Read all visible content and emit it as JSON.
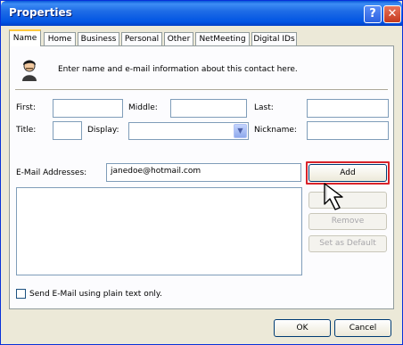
{
  "window": {
    "title": "Properties",
    "help_glyph": "?",
    "close_glyph": "✕"
  },
  "tabs": [
    {
      "label": "Name",
      "active": true
    },
    {
      "label": "Home"
    },
    {
      "label": "Business"
    },
    {
      "label": "Personal"
    },
    {
      "label": "Other"
    },
    {
      "label": "NetMeeting"
    },
    {
      "label": "Digital IDs"
    }
  ],
  "intro_text": "Enter name and e-mail information about this contact here.",
  "name_fields": {
    "first_label": "First:",
    "first_value": "",
    "middle_label": "Middle:",
    "middle_value": "",
    "last_label": "Last:",
    "last_value": "",
    "title_label": "Title:",
    "title_value": "",
    "display_label": "Display:",
    "display_value": "",
    "nickname_label": "Nickname:",
    "nickname_value": ""
  },
  "email": {
    "label": "E-Mail Addresses:",
    "input_value": "janedoe@hotmail.com",
    "list_items": []
  },
  "buttons": {
    "add": "Add",
    "edit": "",
    "remove": "Remove",
    "set_default": "Set as Default",
    "ok": "OK",
    "cancel": "Cancel"
  },
  "plain_text_checkbox": {
    "label": "Send E-Mail using plain text only.",
    "checked": false
  },
  "colors": {
    "titlebar": "#0054e3",
    "highlight": "#d8232a",
    "tab_accent": "#ffc83c"
  }
}
